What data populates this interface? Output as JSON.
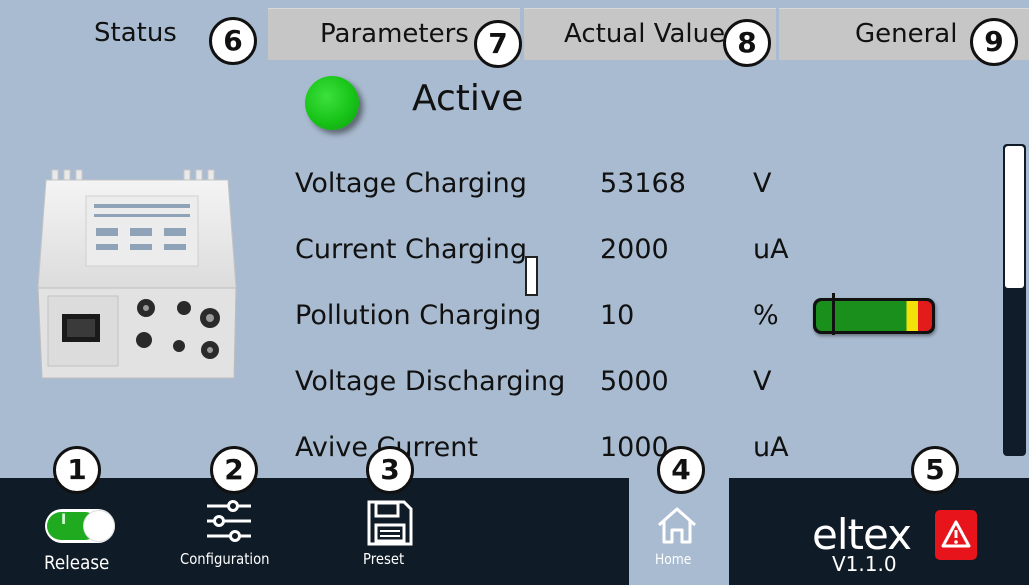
{
  "tabs": [
    {
      "label": "Status",
      "callout": "6"
    },
    {
      "label": "Parameters",
      "callout": "7"
    },
    {
      "label": "Actual Value",
      "callout": "8"
    },
    {
      "label": "General",
      "callout": "9"
    }
  ],
  "status": {
    "text": "Active",
    "led_color": "#1cc41c"
  },
  "values": [
    {
      "name": "Voltage Charging",
      "value": "53168",
      "unit": "V"
    },
    {
      "name": "Current Charging",
      "value": "2000",
      "unit": "uA"
    },
    {
      "name": "Pollution Charging",
      "value": "10",
      "unit": "%"
    },
    {
      "name": "Voltage Discharging",
      "value": "5000",
      "unit": "V"
    },
    {
      "name": "Avive Current",
      "value": "1000",
      "unit": "uA"
    }
  ],
  "pollution_bar": {
    "green": "#1b8f1b",
    "yellow": "#f2e20a",
    "red": "#e41b1b"
  },
  "bottom_nav": {
    "release": {
      "label": "Release",
      "callout": "1",
      "toggle_on": true,
      "toggle_text": "I"
    },
    "configuration": {
      "label": "Configuration",
      "callout": "2"
    },
    "preset": {
      "label": "Preset",
      "callout": "3"
    },
    "home": {
      "label": "Home",
      "callout": "4"
    }
  },
  "brand": {
    "logo": "eltex",
    "version": "V1.1.0",
    "alarm_callout": "5"
  },
  "colors": {
    "background": "#a9bbd0",
    "bottom_bar": "#0f1b26",
    "tab_inactive": "#c6c6c6",
    "alarm": "#e8141c"
  },
  "icons": [
    "toggle-switch-icon",
    "sliders-icon",
    "floppy-disk-icon",
    "home-icon",
    "warning-icon"
  ]
}
